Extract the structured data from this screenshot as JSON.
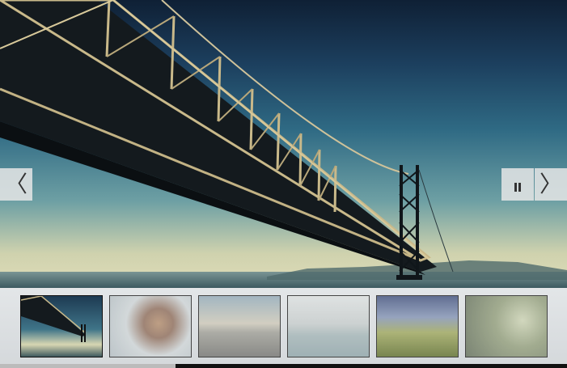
{
  "slideshow": {
    "current_slide": 1,
    "slide_count": 6,
    "progress": 0.31
  },
  "controls": {
    "prev_icon": "chevron-left-icon",
    "pause_icon": "pause-icon",
    "next_icon": "chevron-right-icon",
    "prev_glyph": "〈",
    "next_glyph": "〉"
  },
  "thumbnails": [
    {
      "subject": "bridge"
    },
    {
      "subject": "leaves"
    },
    {
      "subject": "road"
    },
    {
      "subject": "sea-rocks"
    },
    {
      "subject": "barn-field"
    },
    {
      "subject": "plant"
    }
  ],
  "colors": {
    "button_bg": "#e6e6e6",
    "strip_bg": "#dcdfe1",
    "progress": "#bbbbbb"
  }
}
